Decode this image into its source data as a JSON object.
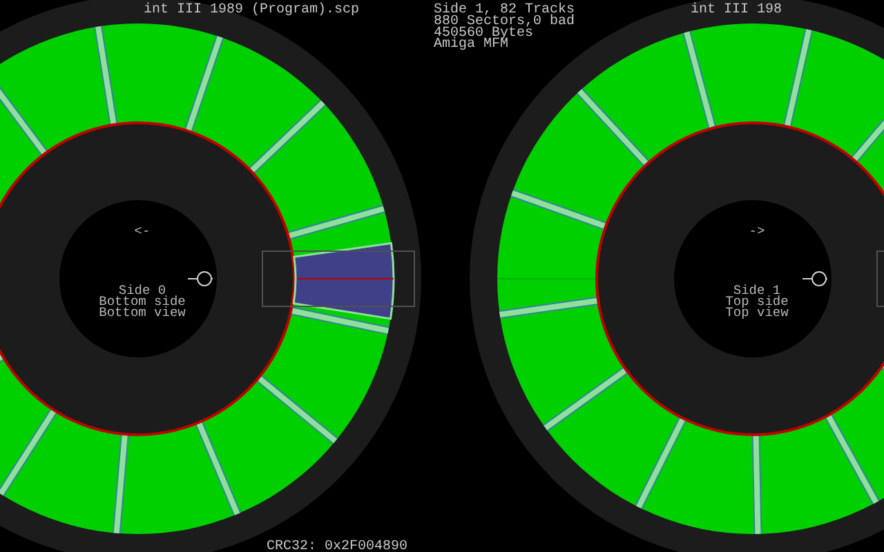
{
  "header": {
    "filename": "int III 1989 (Program).scp",
    "info": [
      "Side 1, 82 Tracks",
      "880 Sectors,0 bad",
      "450560 Bytes",
      "Amiga MFM"
    ],
    "filename_right": "int III 198"
  },
  "disks": [
    {
      "arrow": "<-",
      "labels": [
        "Side 0",
        "Bottom side",
        "Bottom view"
      ],
      "highlighted": true
    },
    {
      "arrow": "->",
      "labels": [
        "Side 1",
        "Top side",
        "Top view"
      ],
      "highlighted": false
    }
  ],
  "crc": "CRC32: 0x2F004890"
}
